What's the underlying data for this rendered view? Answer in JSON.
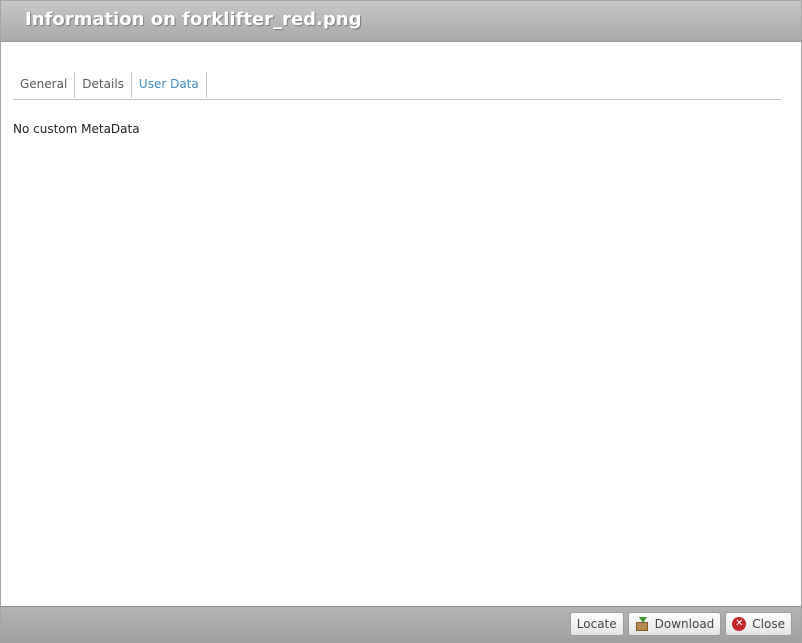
{
  "dialog": {
    "title": "Information on forklifter_red.png"
  },
  "tabs": [
    {
      "label": "General",
      "active": false
    },
    {
      "label": "Details",
      "active": false
    },
    {
      "label": "User Data",
      "active": true
    }
  ],
  "content": {
    "message": "No custom MetaData"
  },
  "footer": {
    "locate_label": "Locate",
    "download_label": "Download",
    "close_label": "Close"
  },
  "icons": {
    "download": "download-package-icon",
    "close": "close-circle-icon"
  },
  "colors": {
    "active_tab": "#3d8cc4",
    "close_icon": "#c4272a"
  }
}
